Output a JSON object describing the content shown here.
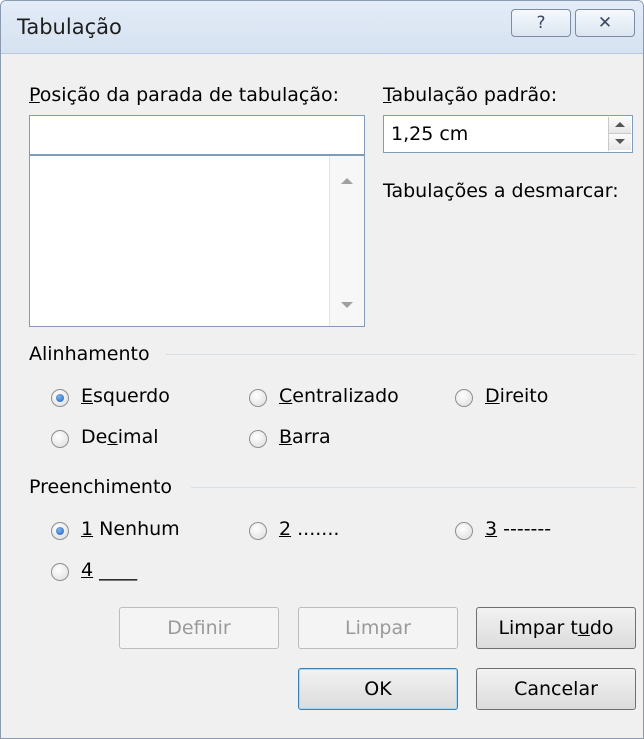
{
  "dialog": {
    "title": "Tabulação",
    "help_glyph": "?",
    "close_glyph": "✕"
  },
  "tab_stop_position": {
    "label": "Posição da parada de tabulação:",
    "value": ""
  },
  "default_tab": {
    "label": "Tabulação padrão:",
    "value": "1,25 cm"
  },
  "tabs_to_clear": {
    "label": "Tabulações a desmarcar:"
  },
  "alignment": {
    "group_label": "Alinhamento",
    "options": [
      {
        "label": "Esquerdo",
        "checked": true
      },
      {
        "label": "Centralizado",
        "checked": false
      },
      {
        "label": "Direito",
        "checked": false
      },
      {
        "label": "Decimal",
        "checked": false
      },
      {
        "label": "Barra",
        "checked": false
      }
    ]
  },
  "leader": {
    "group_label": "Preenchimento",
    "options": [
      {
        "num": "1",
        "text": " Nenhum",
        "checked": true
      },
      {
        "num": "2",
        "text": " .......",
        "checked": false
      },
      {
        "num": "3",
        "text": " -------",
        "checked": false
      },
      {
        "num": "4",
        "text": " ____",
        "checked": false
      }
    ]
  },
  "buttons": {
    "set": "Definir",
    "clear": "Limpar",
    "clear_all": "Limpar tudo",
    "ok": "OK",
    "cancel": "Cancelar"
  }
}
